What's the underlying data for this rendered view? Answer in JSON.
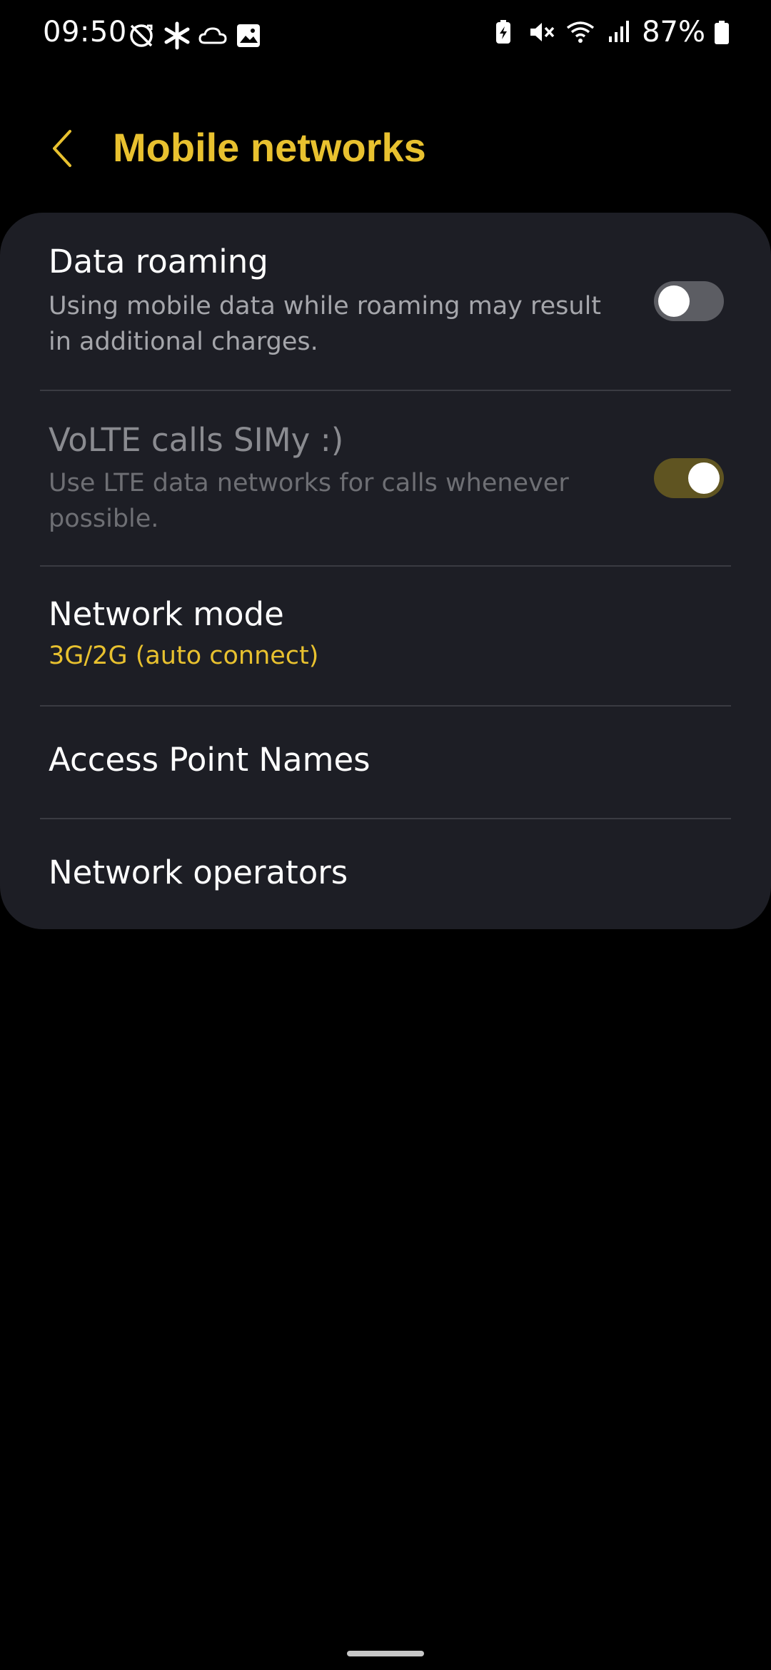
{
  "status_bar": {
    "time": "09:50",
    "battery_percent": "87%",
    "left_icons": [
      "sync-off-icon",
      "asterisk-icon",
      "cloud-icon",
      "image-icon"
    ],
    "right_icons": [
      "battery-saver-icon",
      "mute-icon",
      "wifi-icon",
      "signal-icon",
      "battery-icon"
    ]
  },
  "header": {
    "title": "Mobile networks",
    "back_icon": "chevron-left-icon"
  },
  "settings": {
    "data_roaming": {
      "title": "Data roaming",
      "subtitle": "Using mobile data while roaming may result in additional charges.",
      "enabled": false
    },
    "volte": {
      "title": "VoLTE calls SIMy :)",
      "subtitle": "Use LTE data networks for calls whenever possible.",
      "enabled": true,
      "disabled_state": true
    },
    "network_mode": {
      "title": "Network mode",
      "value": "3G/2G (auto connect)"
    },
    "apn": {
      "title": "Access Point Names"
    },
    "network_operators": {
      "title": "Network operators"
    }
  },
  "colors": {
    "accent": "#e8c12f",
    "card_bg": "#1d1e25",
    "background": "#000000",
    "toggle_on_track": "#5f5421",
    "toggle_off_track": "#5c5d63"
  }
}
